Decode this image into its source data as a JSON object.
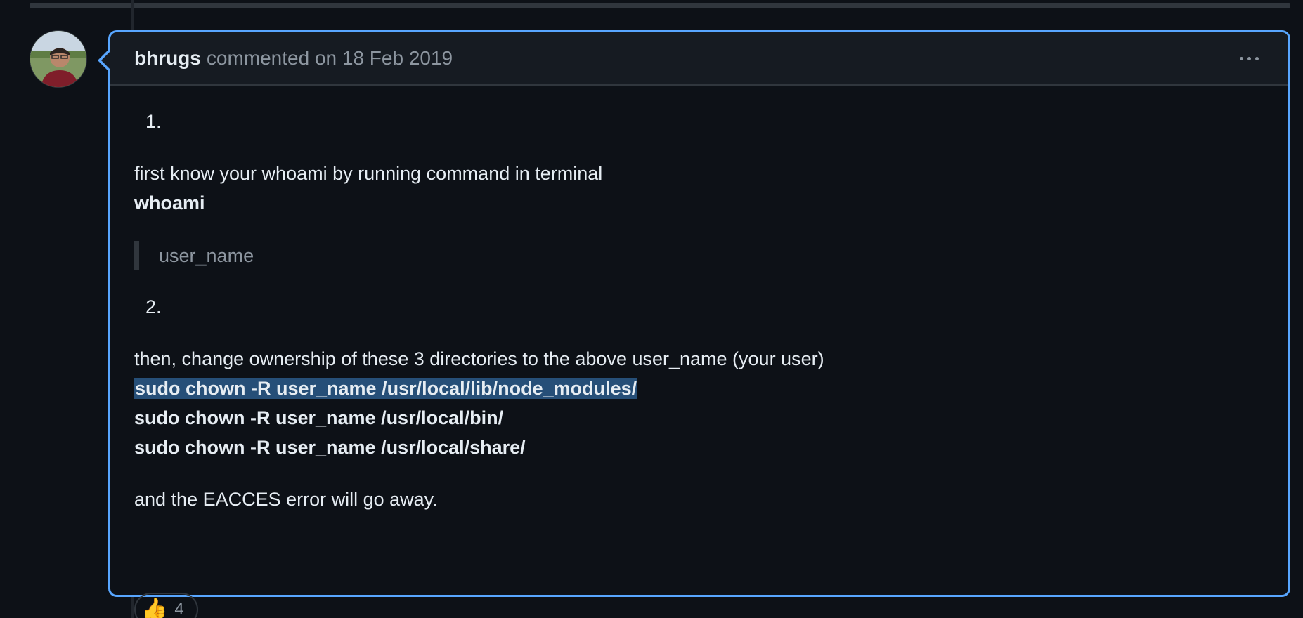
{
  "comment": {
    "author": "bhrugs",
    "meta": "commented on 18 Feb 2019",
    "menu_icon": "kebab-horizontal-icon",
    "body": {
      "item1_number": "1.",
      "item1_text": "first know your whoami by running command in terminal",
      "item1_command": "whoami",
      "item1_quote": "user_name",
      "item2_number": "2.",
      "item2_text": "then, change ownership of these 3 directories to the above user_name (your user)",
      "commands": [
        "sudo chown -R user_name /usr/local/lib/node_modules/",
        "sudo chown -R user_name /usr/local/bin/",
        "sudo chown -R user_name /usr/local/share/"
      ],
      "closing": "and the EACCES error will go away."
    },
    "reaction": {
      "emoji": "👍",
      "icon": "thumbs-up-icon",
      "count": "4"
    }
  },
  "colors": {
    "accent": "#58a6ff",
    "selection": "#264f78",
    "background": "#0d1117",
    "header": "#161b22"
  }
}
